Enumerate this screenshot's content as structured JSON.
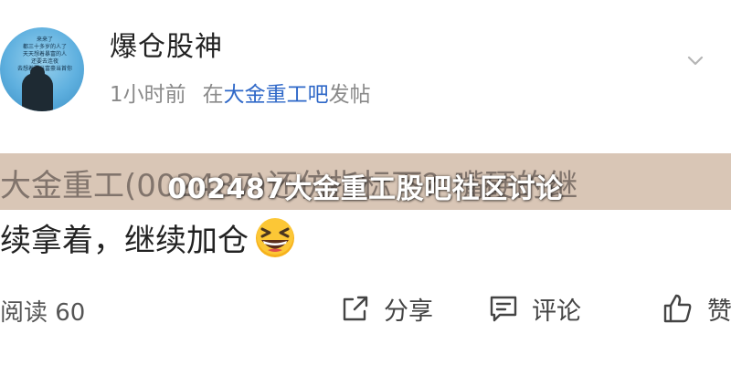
{
  "post": {
    "author": "爆仓股神",
    "avatar_text": "来来了\n都三十多岁的人了\n天天想着暴富的人\n还要去连夜\n去想着要当富豪当首你",
    "time": "1小时前",
    "posted_in_prefix": "在",
    "forum": "大金重工吧",
    "posted_in_suffix": "发帖",
    "line1": "大金重工(002487)还仿指标下？嘴硬的继",
    "line2": "续拿着，继续加仓",
    "emoji": "grinning-squinting-face-emoji"
  },
  "overlay": {
    "title": "002487大金重工股吧社区讨论"
  },
  "footer": {
    "reads": "阅读 60",
    "share_label": "分享",
    "comment_label": "评论",
    "like_label": "赞"
  },
  "colors": {
    "link": "#2f68c8",
    "band": "#d9c6b6",
    "text": "#222222",
    "muted": "#8a8a8a"
  }
}
